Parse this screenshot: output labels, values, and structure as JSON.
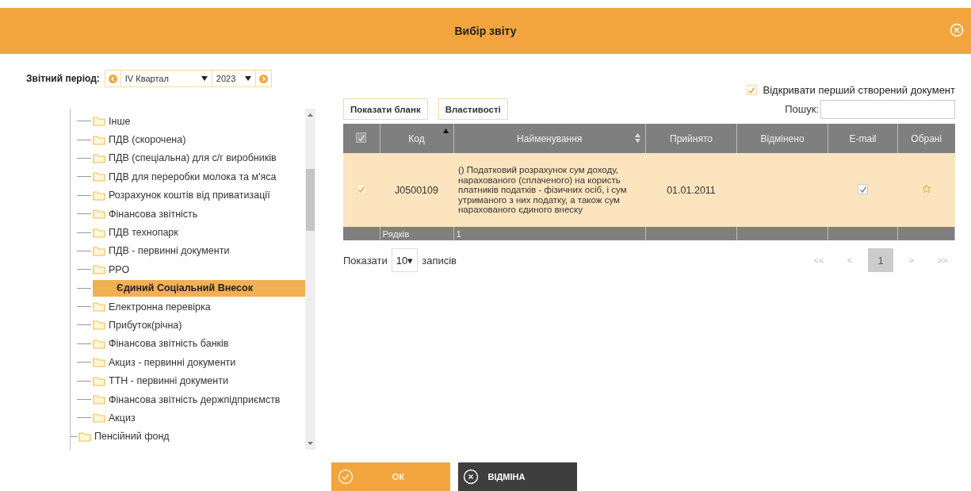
{
  "window": {
    "title": "Вибір звіту"
  },
  "period": {
    "label": "Звітний період:",
    "quarter": "IV Квартал",
    "year": "2023"
  },
  "tree": {
    "items": [
      {
        "children": [
          {
            "label": "Інше",
            "selected": false
          },
          {
            "label": "ПДВ (скорочена)",
            "selected": false
          },
          {
            "label": "ПДВ (спеціальна) для с/г виробників",
            "selected": false
          },
          {
            "label": "ПДВ для переробки молока та м'яса",
            "selected": false
          },
          {
            "label": "Розрахунок коштів від приватизації",
            "selected": false
          },
          {
            "label": "Фінансова звітність",
            "selected": false
          },
          {
            "label": "ПДВ технопарк",
            "selected": false
          },
          {
            "label": "ПДВ - первинні документи",
            "selected": false
          },
          {
            "label": "РРО",
            "selected": false
          },
          {
            "label": "Єдиний Соціальний Внесок",
            "selected": true
          },
          {
            "label": "Електронна перевірка",
            "selected": false
          },
          {
            "label": "Прибуток(річна)",
            "selected": false
          },
          {
            "label": "Фінансова звітність банків",
            "selected": false
          },
          {
            "label": "Акциз - первинні документи",
            "selected": false
          },
          {
            "label": "ТТН - первинні документи",
            "selected": false
          },
          {
            "label": "Фінансова звітність держпідприємств",
            "selected": false
          },
          {
            "label": "Акциз",
            "selected": false
          }
        ]
      },
      {
        "label": "Пенсійний фонд",
        "selected": false
      }
    ]
  },
  "open_first": {
    "label": "Відкривати перший створений документ",
    "checked": true
  },
  "toolbar": [
    "Показати бланк",
    "Властивості"
  ],
  "search": {
    "label": "Пошук:"
  },
  "table": {
    "select_all": {
      "checked": true
    },
    "columns": [
      {
        "label": "Код",
        "sorted": true
      },
      {
        "label": "Найменування",
        "sortable": true
      },
      {
        "label": "Прийнято"
      },
      {
        "label": "Відмінено"
      },
      {
        "label": "E-mail"
      },
      {
        "label": "Обрані"
      }
    ],
    "rows": [
      {
        "selected": true,
        "checked": true,
        "code": "J0500109",
        "name": "() Податковий розрахунок сум доходу, нарахованого (сплаченого) на користь платників податків - фізичних осіб, і сум утриманого з них податку, а також сум нарахованого єдиного внеску",
        "accepted": "01.01.2011",
        "email": true,
        "favorite": false
      }
    ],
    "footer": {
      "label": "Рядків",
      "count": "1"
    }
  },
  "page_size": {
    "before": "Показати",
    "value": "10▾",
    "after": "записів"
  },
  "pagination": [
    {
      "label": "<<",
      "selected": false
    },
    {
      "label": "<",
      "selected": false
    },
    {
      "label": "1",
      "selected": true
    },
    {
      "label": ">",
      "selected": false
    },
    {
      "label": ">>",
      "selected": false
    }
  ],
  "buttons": [
    {
      "kind": "ok",
      "label": "ОК"
    },
    {
      "kind": "cancel",
      "label": "ВІДМІНА"
    }
  ]
}
